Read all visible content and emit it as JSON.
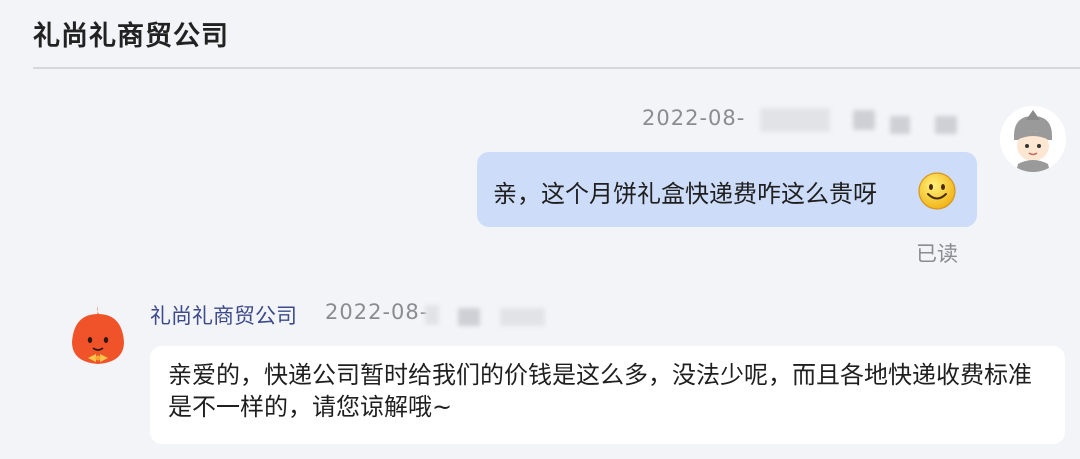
{
  "header": {
    "title": "礼尚礼商贸公司"
  },
  "messages": {
    "outgoing": {
      "timestamp": "2022-08-",
      "text": "亲，这个月饼礼盒快递费咋这么贵呀",
      "emoji": "smiley-face-icon",
      "status": "已读"
    },
    "incoming": {
      "sender": "礼尚礼商贸公司",
      "timestamp": "2022-08-",
      "text": "亲爱的，快递公司暂时给我们的价钱是这么多，没法少呢，而且各地快递收费标准是不一样的，请您谅解哦~"
    }
  },
  "colors": {
    "background": "#f3f4f8",
    "outgoing_bubble": "#cddcf8",
    "incoming_bubble": "#ffffff",
    "sender_name": "#3d4a8a",
    "shop_avatar": "#f0532a"
  }
}
